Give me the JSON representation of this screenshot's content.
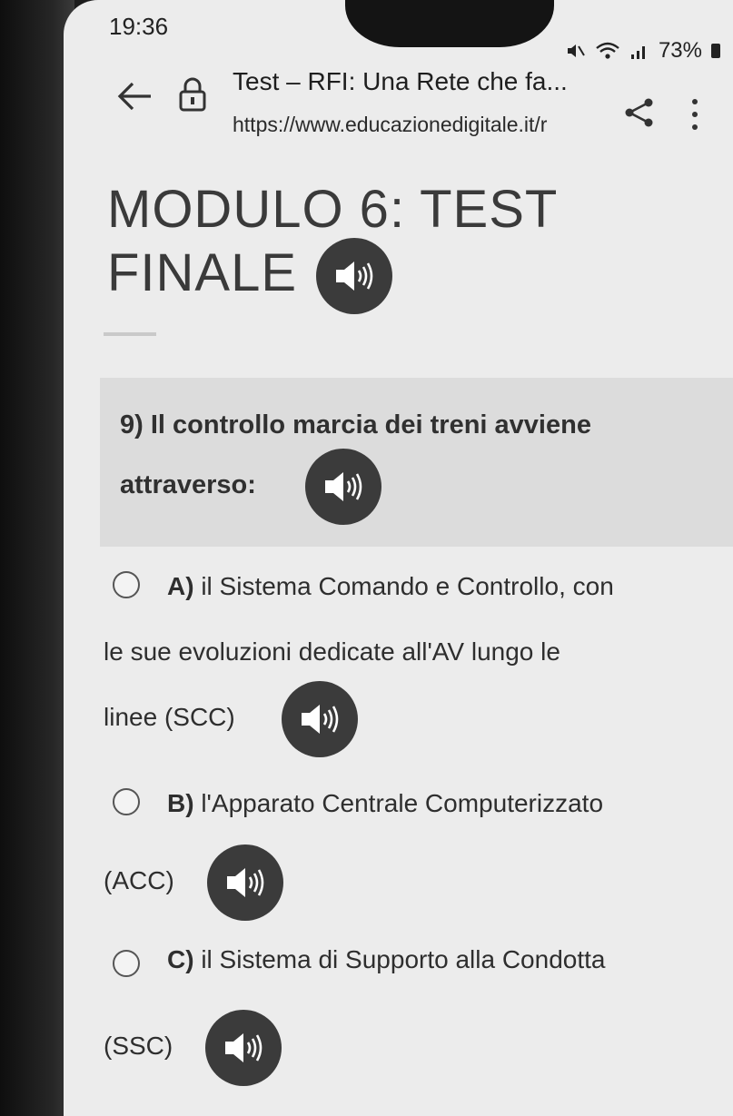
{
  "status": {
    "time": "19:36",
    "battery": "73%"
  },
  "browser": {
    "tab_title": "Test – RFI: Una Rete che fa...",
    "url": "https://www.educazionedigitale.it/r"
  },
  "module": {
    "title_line1": "MODULO 6: TEST",
    "title_line2": "FINALE"
  },
  "question": {
    "line1": "9) Il controllo marcia dei treni avviene",
    "line2": "attraverso:"
  },
  "options": [
    {
      "letter": "A)",
      "line1": "il Sistema Comando e Controllo, con",
      "line2": "le sue evoluzioni dedicate all'AV lungo le",
      "line3": "linee (SCC)"
    },
    {
      "letter": "B)",
      "line1": "l'Apparato Centrale Computerizzato",
      "line2": "(ACC)"
    },
    {
      "letter": "C)",
      "line1": "il Sistema di Supporto alla Condotta",
      "line2": "(SSC)"
    }
  ],
  "icons": {
    "back": "arrow-left-icon",
    "lock": "lock-icon",
    "share": "share-icon",
    "menu": "more-vert-icon",
    "speaker": "speaker-icon"
  },
  "colors": {
    "screen_bg": "#ececec",
    "question_bg": "#dcdcdc",
    "speaker_bg": "#3b3b3b"
  }
}
